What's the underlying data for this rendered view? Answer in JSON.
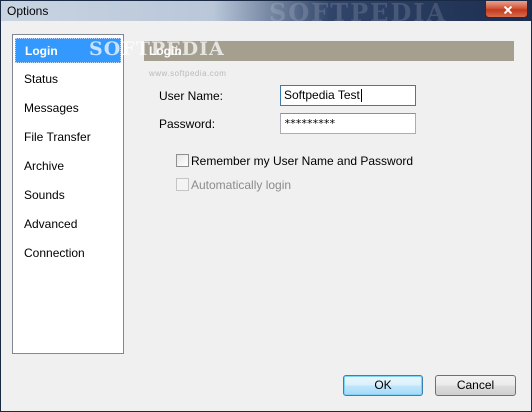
{
  "window": {
    "title": "Options",
    "watermark": "SOFTPEDIA"
  },
  "sidebar": {
    "items": [
      {
        "label": "Login",
        "selected": true
      },
      {
        "label": "Status"
      },
      {
        "label": "Messages"
      },
      {
        "label": "File Transfer"
      },
      {
        "label": "Archive"
      },
      {
        "label": "Sounds"
      },
      {
        "label": "Advanced"
      },
      {
        "label": "Connection"
      }
    ]
  },
  "panel": {
    "header": "Login",
    "watermark": "SOFTPEDIA",
    "watermark_url": "www.softpedia.com",
    "username_label": "User Name:",
    "username_value": "Softpedia Test",
    "password_label": "Password:",
    "password_value": "*********",
    "remember_label": "Remember my User Name and Password",
    "remember_checked": false,
    "autologin_label": "Automatically login",
    "autologin_enabled": false
  },
  "buttons": {
    "ok": "OK",
    "cancel": "Cancel"
  },
  "colors": {
    "selection": "#3399ff",
    "header_bar": "#a49f8f",
    "close_button": "#c94a2c"
  }
}
